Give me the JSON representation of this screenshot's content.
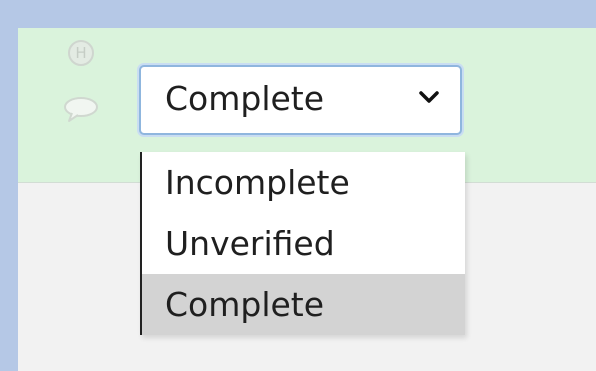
{
  "form": {
    "status_select": {
      "selected": "Complete",
      "options": [
        "Incomplete",
        "Unverified",
        "Complete"
      ]
    },
    "history_icon": {
      "name": "history-icon",
      "glyph": "H"
    },
    "comment_icon": {
      "name": "comment-icon"
    }
  },
  "colors": {
    "page_background": "#b5c8e6",
    "header_background": "#daf3dc",
    "panel_background": "#f2f2f2",
    "selected_option_background": "#d3d3d3",
    "select_border": "#8fb6de"
  }
}
